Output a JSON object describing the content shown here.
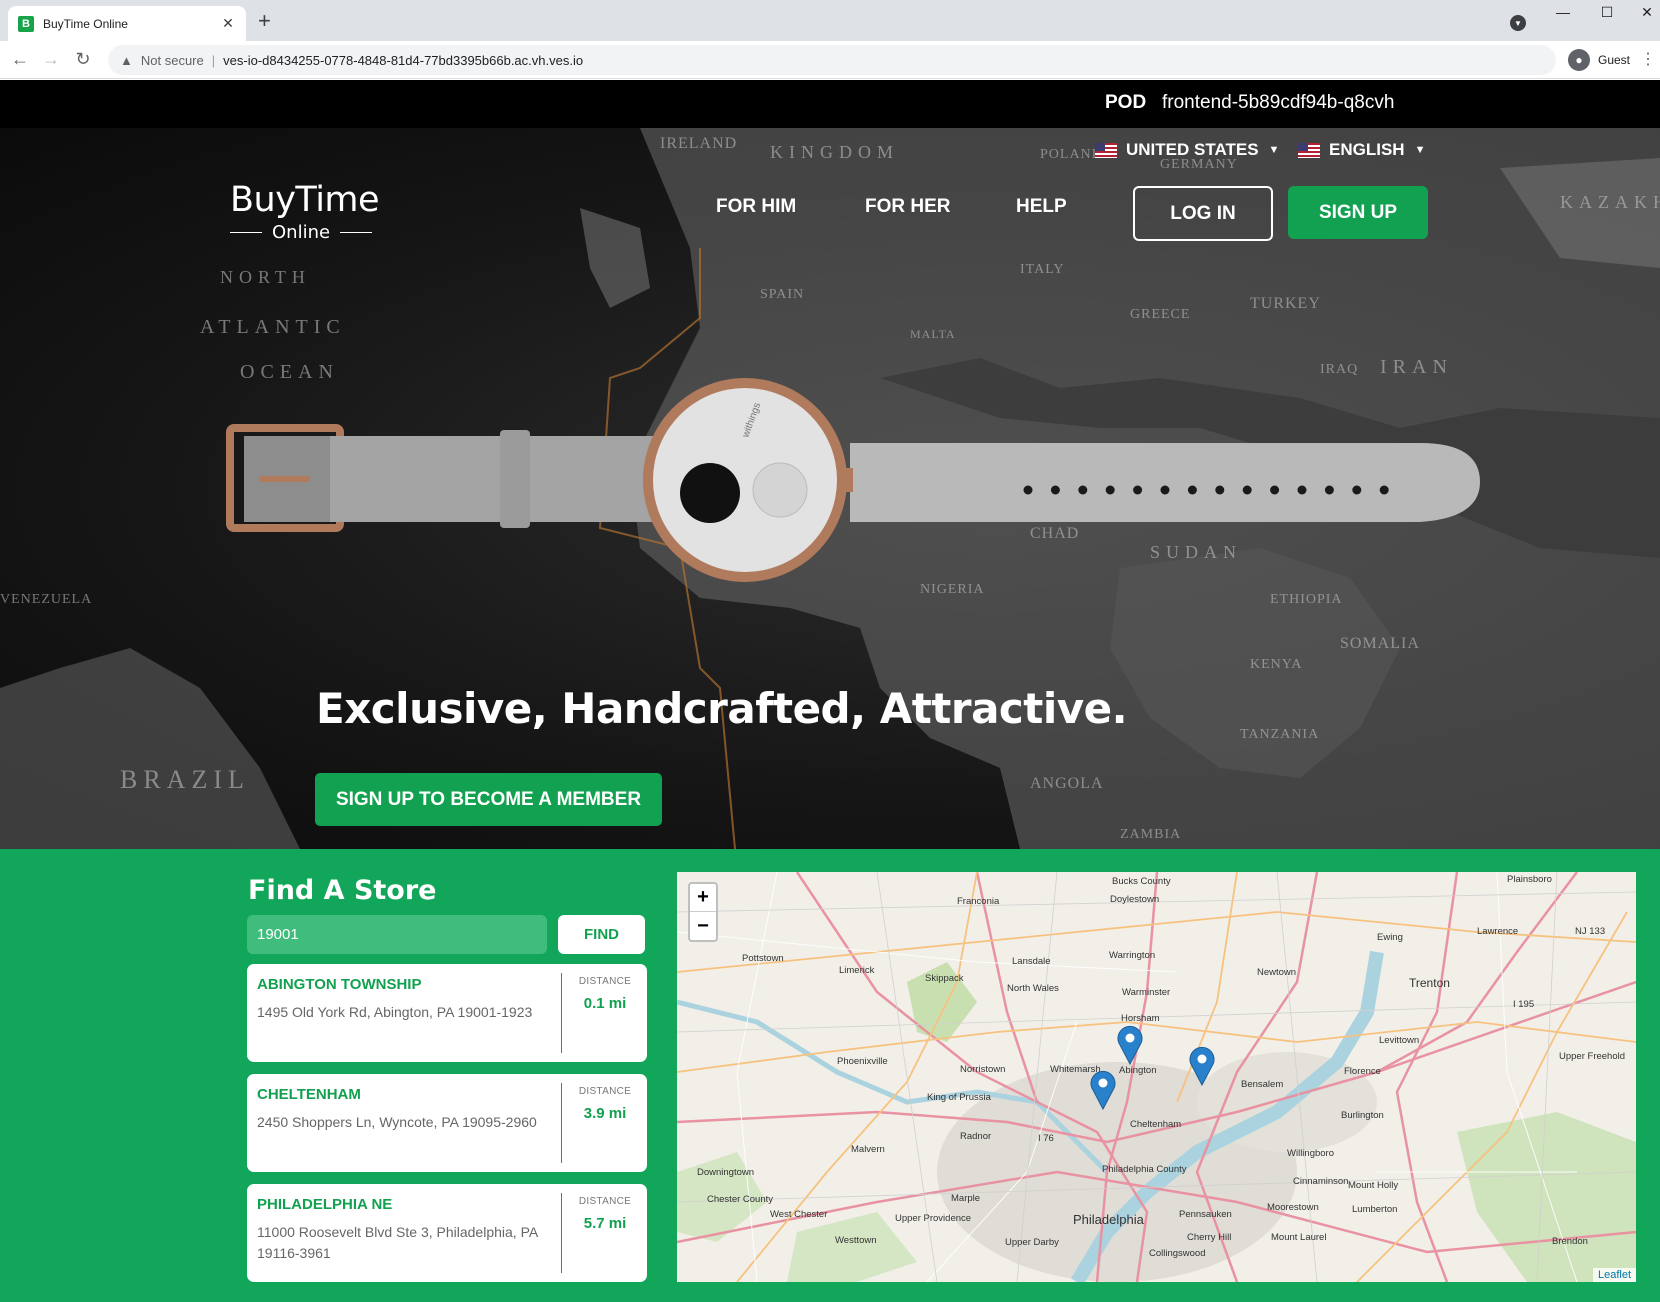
{
  "browser": {
    "tab_title": "BuyTime Online",
    "favicon_letter": "B",
    "not_secure": "Not secure",
    "url": "ves-io-d8434255-0778-4848-81d4-77bd3395b66b.ac.vh.ves.io",
    "profile": "Guest"
  },
  "pod": {
    "label": "POD",
    "value": "frontend-5b89cdf94b-q8cvh"
  },
  "header": {
    "country": "UNITED STATES",
    "language": "ENGLISH",
    "logo_main": "BuyTime",
    "logo_sub": "Online",
    "nav": [
      "FOR HIM",
      "FOR HER",
      "HELP"
    ],
    "login": "LOG IN",
    "signup": "SIGN UP"
  },
  "hero": {
    "tagline": "Exclusive, Handcrafted, Attractive.",
    "cta": "SIGN UP TO BECOME A MEMBER",
    "map_words": [
      "IRELAND",
      "KINGDOM",
      "POLAND",
      "GERMANY",
      "KAZAKH",
      "NORTH",
      "ATLANTIC",
      "OCEAN",
      "SPAIN",
      "ITALY",
      "TURKEY",
      "IRAN",
      "IRAQ",
      "CHAD",
      "SUDAN",
      "NIGERIA",
      "ETHIOPIA",
      "SOMALIA",
      "KENYA",
      "TANZANIA",
      "ANGOLA",
      "BRAZIL",
      "VENEZUELA",
      "ZAMBIA",
      "MALTA",
      "GREECE"
    ],
    "watch_brand": "withings"
  },
  "store": {
    "title": "Find A Store",
    "zip": "19001",
    "find": "FIND",
    "distance_label": "DISTANCE",
    "results": [
      {
        "name": "ABINGTON TOWNSHIP",
        "address": "1495 Old York Rd, Abington, PA 19001-1923",
        "distance": "0.1 mi"
      },
      {
        "name": "CHELTENHAM",
        "address": "2450 Shoppers Ln, Wyncote, PA 19095-2960",
        "distance": "3.9 mi"
      },
      {
        "name": "PHILADELPHIA NE",
        "address": "11000 Roosevelt Blvd Ste 3, Philadelphia, PA 19116-3961",
        "distance": "5.7 mi"
      }
    ]
  },
  "map": {
    "zoom_in": "+",
    "zoom_out": "−",
    "attribution": "Leaflet",
    "places": [
      "Plainsboro",
      "Bucks County",
      "Doylestown",
      "Franconia",
      "NJ 133",
      "Ewing",
      "Lawrence",
      "Pottstown",
      "Limerick",
      "Lansdale",
      "Warrington",
      "Newtown",
      "Skippack",
      "North Wales",
      "Warminster",
      "Trenton",
      "Horsham",
      "I 195",
      "Levittown",
      "Phoenixville",
      "Norristown",
      "Whitemarsh",
      "Abington",
      "Florence",
      "Upper Freehold",
      "Bensalem",
      "King of Prussia",
      "Cheltenham",
      "Burlington",
      "Radnor",
      "I 76",
      "Malvern",
      "Willingboro",
      "Downingtown",
      "Philadelphia County",
      "Cinnaminson",
      "Mount Holly",
      "Chester County",
      "Marple",
      "Moorestown",
      "Lumberton",
      "West Chester",
      "Upper Providence",
      "Philadelphia",
      "Pennsauken",
      "Westtown",
      "Upper Darby",
      "Cherry Hill",
      "Mount Laurel",
      "Collingswood",
      "Brendon"
    ]
  }
}
